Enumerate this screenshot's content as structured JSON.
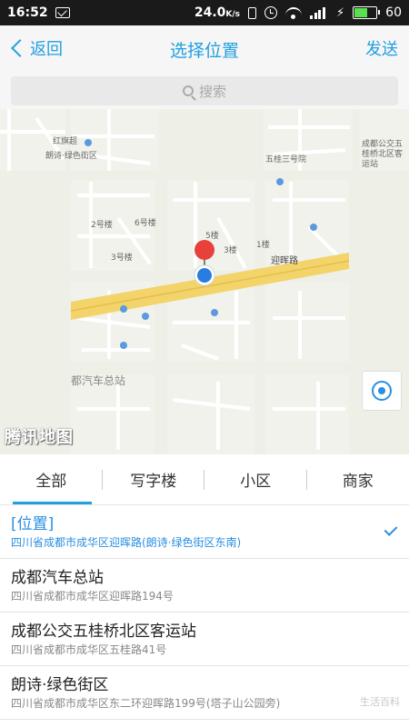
{
  "status": {
    "time": "16:52",
    "speed_value": "24.0",
    "speed_unit": "K/s",
    "battery": "60",
    "battery_level_percent": 60
  },
  "nav": {
    "back_label": "返回",
    "title": "选择位置",
    "send_label": "发送"
  },
  "search": {
    "placeholder": "搜索"
  },
  "map": {
    "watermark": "腾讯地图",
    "labels": {
      "hongqi": "红旗超",
      "langshi": "朗诗·绿色街区",
      "wugui_road3": "五桂三号院",
      "bus_station": "成都公交五桂桥北区客运站",
      "building2": "2号楼",
      "building6": "6号楼",
      "building3": "3号楼",
      "building5": "5楼",
      "building1": "1楼",
      "building3b": "3楼",
      "yinghui_road": "迎晖路",
      "coach_station": "都汽车总站"
    }
  },
  "tabs": [
    {
      "label": "全部",
      "active": true
    },
    {
      "label": "写字楼",
      "active": false
    },
    {
      "label": "小区",
      "active": false
    },
    {
      "label": "商家",
      "active": false
    }
  ],
  "pois": [
    {
      "name": "[位置]",
      "address": "四川省成都市成华区迎晖路(朗诗·绿色街区东南)",
      "selected": true
    },
    {
      "name": "成都汽车总站",
      "address": "四川省成都市成华区迎晖路194号",
      "selected": false
    },
    {
      "name": "成都公交五桂桥北区客运站",
      "address": "四川省成都市成华区五桂路41号",
      "selected": false
    },
    {
      "name": "朗诗·绿色街区",
      "address": "四川省成都市成华区东二环迎晖路199号(塔子山公园旁)",
      "selected": false
    }
  ],
  "corner_watermark": "生活百科",
  "colors": {
    "accent": "#21a0e0",
    "road": "#f3d46a",
    "pin_red": "#e8413c",
    "pin_blue": "#2a7de0"
  }
}
